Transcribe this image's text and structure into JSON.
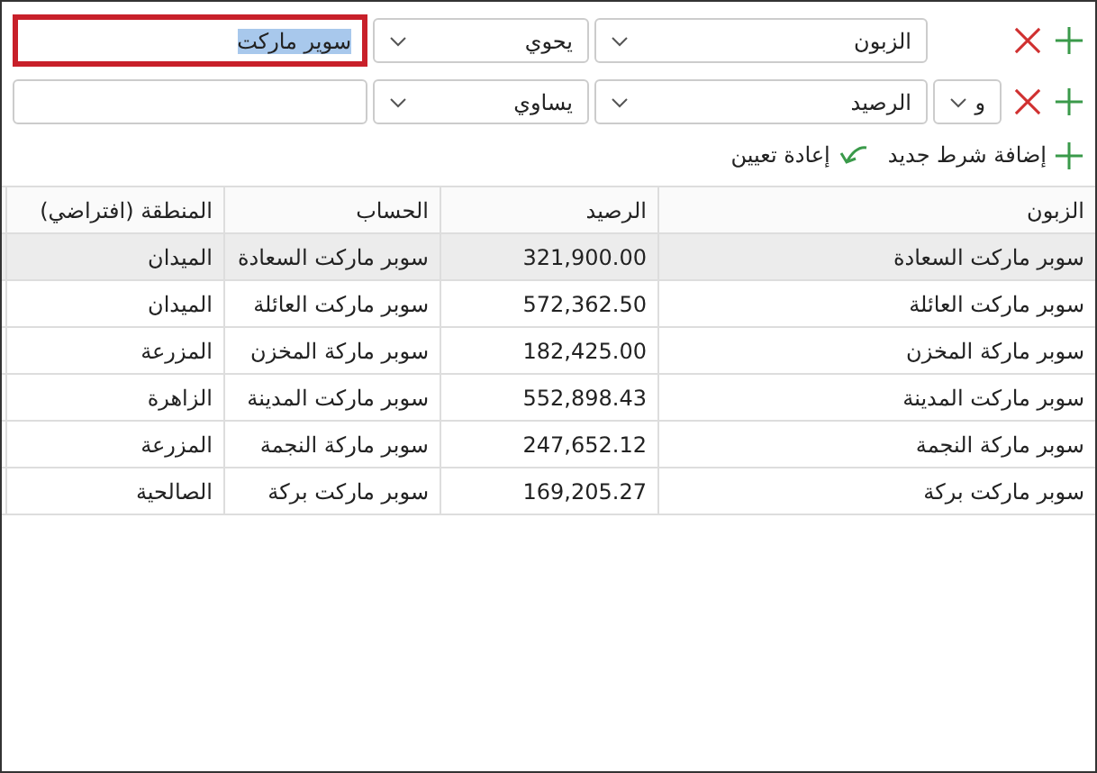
{
  "conditions": [
    {
      "field": "الزبون",
      "operator": "يحوي",
      "value": "سوير ماركت",
      "focused": true
    },
    {
      "connector": "و",
      "field": "الرصيد",
      "operator": "يساوي",
      "focused": false
    }
  ],
  "actions": {
    "add_condition": "إضافة شرط جديد",
    "reset": "إعادة تعيين"
  },
  "table": {
    "columns": [
      "الزبون",
      "الرصيد",
      "الحساب",
      "المنطقة (افتراضي)"
    ],
    "rows": [
      {
        "selected": true,
        "cells": [
          "سوبر ماركت السعادة",
          "321,900.00",
          "سوبر ماركت السعادة",
          "الميدان"
        ]
      },
      {
        "selected": false,
        "cells": [
          "سوبر ماركت العائلة",
          "572,362.50",
          "سوبر ماركت العائلة",
          "الميدان"
        ]
      },
      {
        "selected": false,
        "cells": [
          "سوبر ماركة المخزن",
          "182,425.00",
          "سوبر ماركة المخزن",
          "المزرعة"
        ]
      },
      {
        "selected": false,
        "cells": [
          "سوبر ماركت المدينة",
          "552,898.43",
          "سوبر ماركت المدينة",
          "الزاهرة"
        ]
      },
      {
        "selected": false,
        "cells": [
          "سوبر ماركة النجمة",
          "247,652.12",
          "سوبر ماركة النجمة",
          "المزرعة"
        ]
      },
      {
        "selected": false,
        "cells": [
          "سوبر ماركت بركة",
          "169,205.27",
          "سوبر ماركت بركة",
          "الصالحية"
        ]
      }
    ]
  }
}
